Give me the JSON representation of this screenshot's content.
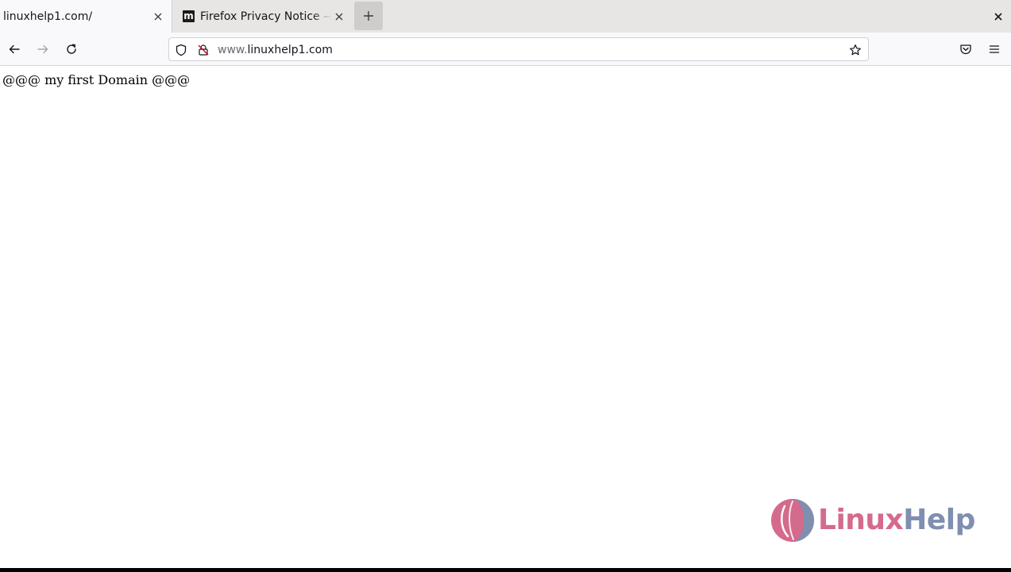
{
  "tabs": [
    {
      "title": "linuxhelp1.com/",
      "active": true
    },
    {
      "title": "Firefox Privacy Notice — Mozilla",
      "active": false,
      "favicon": "mozilla-m-icon",
      "favicon_letter": "m"
    }
  ],
  "toolbar": {
    "back": "back-arrow-icon",
    "forward": "forward-arrow-icon",
    "reload": "reload-icon",
    "pocket": "pocket-icon",
    "menu": "hamburger-menu-icon"
  },
  "urlbar": {
    "prefix": "www.",
    "domain": "linuxhelp1.com",
    "security_icon": "shield-icon",
    "connection_icon": "insecure-lock-icon",
    "bookmark_icon": "star-icon"
  },
  "page": {
    "body_text": "@@@ my first Domain @@@"
  },
  "watermark": {
    "brand_part1": "Linux",
    "brand_part2": "Help",
    "colors": {
      "pink": "#d46a8c",
      "blue": "#7f8fb0"
    }
  }
}
